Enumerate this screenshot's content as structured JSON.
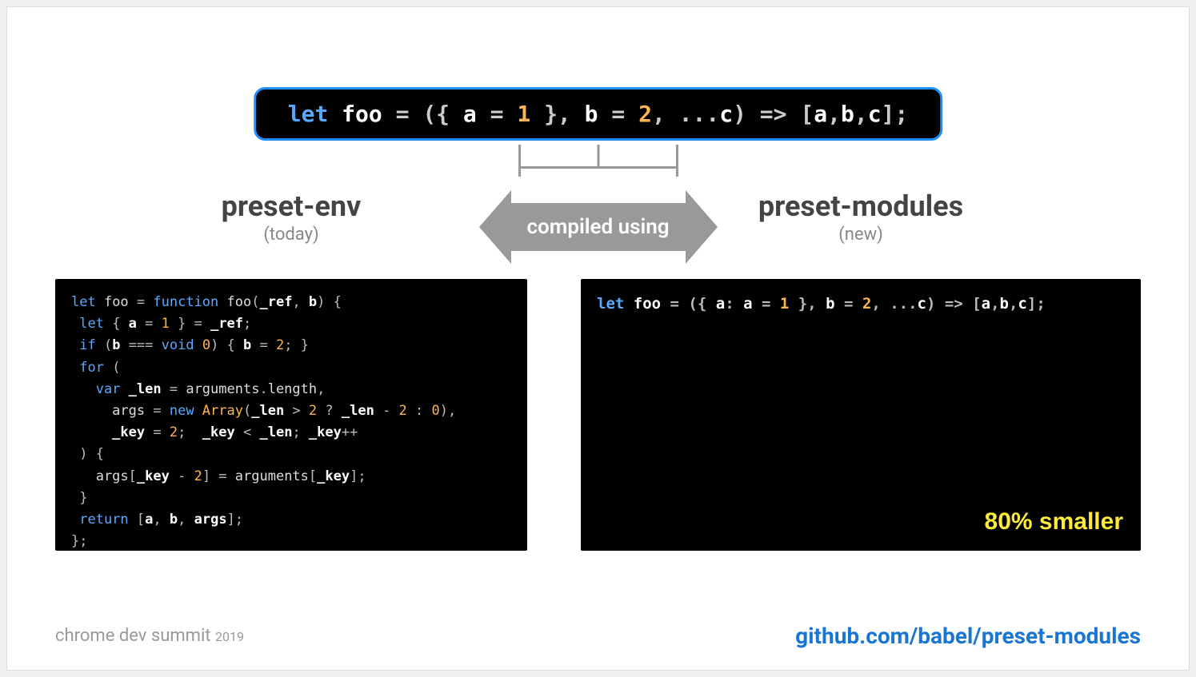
{
  "source_code": {
    "tokens": [
      {
        "t": "let ",
        "c": "kw"
      },
      {
        "t": "foo ",
        "c": "id"
      },
      {
        "t": "= ({ ",
        "c": "pun"
      },
      {
        "t": "a ",
        "c": "id"
      },
      {
        "t": "= ",
        "c": "pun"
      },
      {
        "t": "1 ",
        "c": "num"
      },
      {
        "t": "}, ",
        "c": "pun"
      },
      {
        "t": "b ",
        "c": "id"
      },
      {
        "t": "= ",
        "c": "pun"
      },
      {
        "t": "2",
        "c": "num"
      },
      {
        "t": ", ...",
        "c": "pun"
      },
      {
        "t": "c",
        "c": "id"
      },
      {
        "t": ") => [",
        "c": "pun"
      },
      {
        "t": "a",
        "c": "id"
      },
      {
        "t": ",",
        "c": "pun"
      },
      {
        "t": "b",
        "c": "id"
      },
      {
        "t": ",",
        "c": "pun"
      },
      {
        "t": "c",
        "c": "id"
      },
      {
        "t": "];",
        "c": "pun"
      }
    ]
  },
  "connector_label": "compiled using",
  "left": {
    "title": "preset-env",
    "subtitle": "(today)",
    "code_lines": [
      [
        {
          "t": "let ",
          "c": "kw"
        },
        {
          "t": "foo ",
          "c": "dim"
        },
        {
          "t": "= ",
          "c": "pun"
        },
        {
          "t": "function ",
          "c": "kw"
        },
        {
          "t": "foo",
          "c": "dim"
        },
        {
          "t": "(",
          "c": "pun"
        },
        {
          "t": "_ref",
          "c": "id"
        },
        {
          "t": ", ",
          "c": "pun"
        },
        {
          "t": "b",
          "c": "id"
        },
        {
          "t": ") {",
          "c": "pun"
        }
      ],
      [
        {
          "t": " let ",
          "c": "kw"
        },
        {
          "t": "{ ",
          "c": "pun"
        },
        {
          "t": "a ",
          "c": "id"
        },
        {
          "t": "= ",
          "c": "pun"
        },
        {
          "t": "1 ",
          "c": "num"
        },
        {
          "t": "} = ",
          "c": "pun"
        },
        {
          "t": "_ref",
          "c": "id"
        },
        {
          "t": ";",
          "c": "pun"
        }
      ],
      [
        {
          "t": " if ",
          "c": "kw"
        },
        {
          "t": "(",
          "c": "pun"
        },
        {
          "t": "b ",
          "c": "id"
        },
        {
          "t": "=== ",
          "c": "pun"
        },
        {
          "t": "void ",
          "c": "kw"
        },
        {
          "t": "0",
          "c": "num"
        },
        {
          "t": ") { ",
          "c": "pun"
        },
        {
          "t": "b ",
          "c": "id"
        },
        {
          "t": "= ",
          "c": "pun"
        },
        {
          "t": "2",
          "c": "num"
        },
        {
          "t": "; }",
          "c": "pun"
        }
      ],
      [
        {
          "t": " for ",
          "c": "kw"
        },
        {
          "t": "(",
          "c": "pun"
        }
      ],
      [
        {
          "t": "   var ",
          "c": "kw"
        },
        {
          "t": "_len ",
          "c": "id"
        },
        {
          "t": "= ",
          "c": "pun"
        },
        {
          "t": "arguments",
          "c": "dim"
        },
        {
          "t": ".",
          "c": "pun"
        },
        {
          "t": "length",
          "c": "dim"
        },
        {
          "t": ",",
          "c": "pun"
        }
      ],
      [
        {
          "t": "     args ",
          "c": "dim"
        },
        {
          "t": "= ",
          "c": "pun"
        },
        {
          "t": "new ",
          "c": "kw"
        },
        {
          "t": "Array",
          "c": "num"
        },
        {
          "t": "(",
          "c": "pun"
        },
        {
          "t": "_len ",
          "c": "id"
        },
        {
          "t": "> ",
          "c": "pun"
        },
        {
          "t": "2 ",
          "c": "num"
        },
        {
          "t": "? ",
          "c": "pun"
        },
        {
          "t": "_len ",
          "c": "id"
        },
        {
          "t": "- ",
          "c": "pun"
        },
        {
          "t": "2 ",
          "c": "num"
        },
        {
          "t": ": ",
          "c": "pun"
        },
        {
          "t": "0",
          "c": "num"
        },
        {
          "t": "),",
          "c": "pun"
        }
      ],
      [
        {
          "t": "     _key ",
          "c": "id"
        },
        {
          "t": "= ",
          "c": "pun"
        },
        {
          "t": "2",
          "c": "num"
        },
        {
          "t": ";  ",
          "c": "pun"
        },
        {
          "t": "_key ",
          "c": "id"
        },
        {
          "t": "< ",
          "c": "pun"
        },
        {
          "t": "_len",
          "c": "id"
        },
        {
          "t": "; ",
          "c": "pun"
        },
        {
          "t": "_key",
          "c": "id"
        },
        {
          "t": "++",
          "c": "pun"
        }
      ],
      [
        {
          "t": " ) {",
          "c": "pun"
        }
      ],
      [
        {
          "t": "   args",
          "c": "dim"
        },
        {
          "t": "[",
          "c": "pun"
        },
        {
          "t": "_key ",
          "c": "id"
        },
        {
          "t": "- ",
          "c": "pun"
        },
        {
          "t": "2",
          "c": "num"
        },
        {
          "t": "] = ",
          "c": "pun"
        },
        {
          "t": "arguments",
          "c": "dim"
        },
        {
          "t": "[",
          "c": "pun"
        },
        {
          "t": "_key",
          "c": "id"
        },
        {
          "t": "];",
          "c": "pun"
        }
      ],
      [
        {
          "t": " }",
          "c": "pun"
        }
      ],
      [
        {
          "t": " return ",
          "c": "kw"
        },
        {
          "t": "[",
          "c": "pun"
        },
        {
          "t": "a",
          "c": "id"
        },
        {
          "t": ", ",
          "c": "pun"
        },
        {
          "t": "b",
          "c": "id"
        },
        {
          "t": ", ",
          "c": "pun"
        },
        {
          "t": "args",
          "c": "id"
        },
        {
          "t": "];",
          "c": "pun"
        }
      ],
      [
        {
          "t": "};",
          "c": "pun"
        }
      ]
    ]
  },
  "right": {
    "title": "preset-modules",
    "subtitle": "(new)",
    "code_lines": [
      [
        {
          "t": "let ",
          "c": "kw"
        },
        {
          "t": "foo ",
          "c": "id"
        },
        {
          "t": "= ({ ",
          "c": "pun"
        },
        {
          "t": "a",
          "c": "id"
        },
        {
          "t": ": ",
          "c": "pun"
        },
        {
          "t": "a ",
          "c": "id"
        },
        {
          "t": "= ",
          "c": "pun"
        },
        {
          "t": "1 ",
          "c": "num"
        },
        {
          "t": "}, ",
          "c": "pun"
        },
        {
          "t": "b ",
          "c": "id"
        },
        {
          "t": "= ",
          "c": "pun"
        },
        {
          "t": "2",
          "c": "num"
        },
        {
          "t": ", ...",
          "c": "pun"
        },
        {
          "t": "c",
          "c": "id"
        },
        {
          "t": ") => [",
          "c": "pun"
        },
        {
          "t": "a",
          "c": "id"
        },
        {
          "t": ",",
          "c": "pun"
        },
        {
          "t": "b",
          "c": "id"
        },
        {
          "t": ",",
          "c": "pun"
        },
        {
          "t": "c",
          "c": "id"
        },
        {
          "t": "];",
          "c": "pun"
        }
      ]
    ],
    "badge": "80% smaller"
  },
  "footer": {
    "event": "chrome dev summit",
    "year": "2019",
    "link": "github.com/babel/preset-modules"
  }
}
